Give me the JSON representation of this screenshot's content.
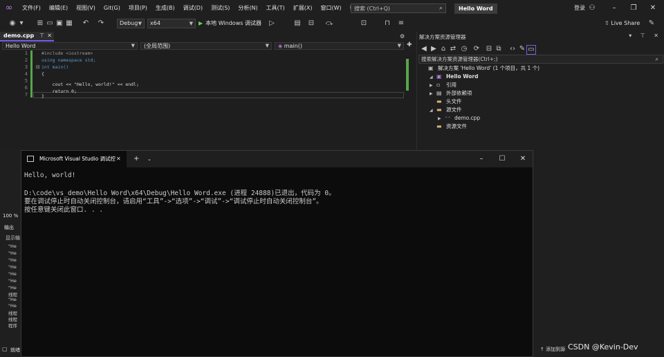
{
  "menubar": {
    "items": [
      "文件(F)",
      "编辑(E)",
      "视图(V)",
      "Git(G)",
      "项目(P)",
      "生成(B)",
      "调试(D)",
      "测试(S)",
      "分析(N)",
      "工具(T)",
      "扩展(X)",
      "窗口(W)",
      "帮助(H)"
    ],
    "search_placeholder": "搜索 (Ctrl+Q)",
    "solution_title": "Hello Word",
    "login": "登录"
  },
  "toolbar": {
    "config": "Debug",
    "platform": "x64",
    "run_label": "本地 Windows 调试器",
    "live_share": "Live Share"
  },
  "editor": {
    "tab": "demo.cpp",
    "nav_project": "Hello Word",
    "nav_scope": "(全局范围)",
    "nav_member": "main()",
    "line_numbers": [
      "1",
      "2",
      "3",
      "4",
      "5",
      "6",
      "7"
    ],
    "lines": [
      "#include <iostream>",
      "using namespace std;",
      "int main()",
      "{",
      "    cout << \"Hello, world!\" << endl;",
      "    return 0;",
      "}"
    ]
  },
  "solution_explorer": {
    "title": "解决方案资源管理器",
    "search_placeholder": "搜索解决方案资源管理器(Ctrl+;)",
    "tree": [
      {
        "label": "解决方案 'Hello Word' (1 个项目，共 1 个)",
        "icon": "solution-icon"
      },
      {
        "label": "Hello Word",
        "icon": "project-icon"
      },
      {
        "label": "引用",
        "icon": "references-icon"
      },
      {
        "label": "外部依赖项",
        "icon": "external-deps-icon"
      },
      {
        "label": "头文件",
        "icon": "folder-icon"
      },
      {
        "label": "源文件",
        "icon": "folder-icon"
      },
      {
        "label": "demo.cpp",
        "icon": "cpp-file-icon"
      },
      {
        "label": "资源文件",
        "icon": "folder-icon"
      }
    ]
  },
  "output_panel": {
    "zoom": "100 %",
    "title": "输出",
    "show_from": "显示输",
    "lines": [
      "\"He",
      "\"He",
      "\"He",
      "\"He",
      "\"He",
      "\"He",
      "\"He",
      "线程",
      "\"He",
      "\"He",
      "线程",
      "线程",
      "程序"
    ]
  },
  "console": {
    "tab_title": "Microsoft Visual Studio 调试控",
    "lines": [
      "Hello, world!",
      "",
      "D:\\code\\vs_demo\\Hello Word\\x64\\Debug\\Hello Word.exe (进程 24888)已退出，代码为 0。",
      "要在调试停止时自动关闭控制台，请启用“工具”->“选项”->“调试”->“调试停止时自动关闭控制台”。",
      "按任意键关闭此窗口. . ."
    ]
  },
  "statusbar": {
    "left_label": "就绪",
    "add_to_source": "添加到源",
    "watermark": "CSDN @Kevin-Dev"
  }
}
